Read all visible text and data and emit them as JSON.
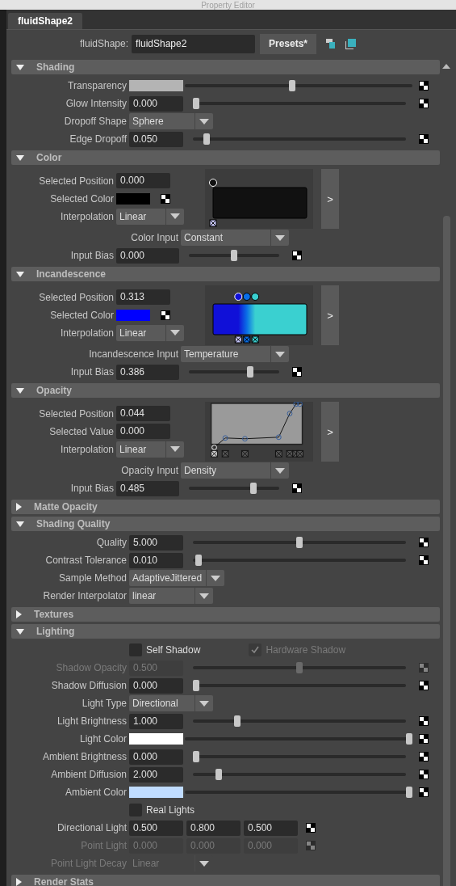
{
  "window": {
    "title": "Property Editor"
  },
  "tabs": [
    {
      "label": "fluidShape2",
      "selected": true
    }
  ],
  "header": {
    "label": "fluidShape:",
    "value": "fluidShape2",
    "button": "Presets*"
  },
  "sections": [
    {
      "title": "Shading",
      "expanded": true,
      "rows": [
        {
          "kind": "slider",
          "label": "Transparency",
          "color": "#b4b4b4",
          "level": 0.47,
          "disabled": false
        },
        {
          "kind": "slider",
          "label": "Glow Intensity",
          "value": "0.000",
          "level": 0,
          "disabled": false
        },
        {
          "kind": "dropdown",
          "label": "Dropoff Shape",
          "value": "Sphere",
          "disabled": false
        },
        {
          "kind": "slider",
          "label": "Edge Dropoff",
          "value": "0.050",
          "level": 0.05,
          "disabled": false
        }
      ]
    },
    {
      "title": "Color",
      "expanded": true,
      "rows": [
        {
          "kind": "gradient_ramp",
          "fields": [
            {
              "kind": "field",
              "label": "Selected Position",
              "value": "0.000"
            },
            {
              "kind": "swatch",
              "label": "Selected Color",
              "color": "#000000"
            },
            {
              "kind": "dropdown",
              "label": "Interpolation",
              "value": "Linear"
            }
          ],
          "ramp": {
            "stops": [
              {
                "color": "#111111",
                "selected": true
              }
            ]
          },
          "button": ">"
        },
        {
          "kind": "input_dropdown",
          "label": "Color Input",
          "value": "Constant",
          "disabled": false
        },
        {
          "kind": "bias",
          "label": "Input Bias",
          "value": "0.000",
          "level": 0.5,
          "disabled": false
        }
      ]
    },
    {
      "title": "Incandescence",
      "expanded": true,
      "rows": [
        {
          "kind": "gradient_ramp",
          "fields": [
            {
              "kind": "field",
              "label": "Selected Position",
              "value": "0.313"
            },
            {
              "kind": "swatch",
              "label": "Selected Color",
              "color": "#0000ff"
            },
            {
              "kind": "dropdown",
              "label": "Interpolation",
              "value": "Linear"
            }
          ],
          "ramp": {
            "stops": [
              {
                "color": "#1010d8",
                "selected": true
              },
              {
                "color": "#0a6ee6",
                "selected": false
              },
              {
                "color": "#3ad0d0",
                "selected": false
              }
            ]
          },
          "button": ">"
        },
        {
          "kind": "input_dropdown",
          "label": "Incandescence Input",
          "value": "Temperature",
          "disabled": false
        },
        {
          "kind": "bias",
          "label": "Input Bias",
          "value": "0.386",
          "level": 0.69,
          "disabled": false
        }
      ]
    },
    {
      "title": "Opacity",
      "expanded": true,
      "rows": [
        {
          "kind": "curve_ramp",
          "fields": [
            {
              "kind": "field",
              "label": "Selected Position",
              "value": "0.044"
            },
            {
              "kind": "field",
              "label": "Selected Value",
              "value": "0.000"
            },
            {
              "kind": "dropdown",
              "label": "Interpolation",
              "value": "Linear"
            }
          ],
          "ramp": {
            "stops": [
              {
                "selected": true
              },
              {
                "selected": false
              },
              {
                "selected": false
              },
              {
                "selected": false
              },
              {
                "selected": false
              },
              {
                "selected": false
              },
              {
                "selected": false
              }
            ]
          },
          "button": ">"
        },
        {
          "kind": "input_dropdown",
          "label": "Opacity Input",
          "value": "Density",
          "disabled": false
        },
        {
          "kind": "bias",
          "label": "Input Bias",
          "value": "0.485",
          "level": 0.73,
          "disabled": false
        }
      ]
    },
    {
      "title": "Matte Opacity",
      "expanded": false
    },
    {
      "title": "Shading Quality",
      "expanded": true,
      "rows": [
        {
          "kind": "slider",
          "label": "Quality",
          "value": "5.000",
          "level": 0.5,
          "disabled": false
        },
        {
          "kind": "slider",
          "label": "Contrast Tolerance",
          "value": "0.010",
          "level": 0.01,
          "disabled": false
        },
        {
          "kind": "dropdown",
          "label": "Sample Method",
          "value": "AdaptiveJittered",
          "disabled": false
        },
        {
          "kind": "dropdown",
          "label": "Render Interpolator",
          "value": "linear",
          "disabled": false
        }
      ]
    },
    {
      "title": "Textures",
      "expanded": false
    },
    {
      "title": "Lighting",
      "expanded": true,
      "rows": [
        {
          "kind": "checks",
          "items": [
            {
              "label": "Self Shadow",
              "checked": false,
              "disabled": false
            },
            {
              "label": "Hardware Shadow",
              "checked": true,
              "disabled": true
            }
          ]
        },
        {
          "kind": "slider",
          "label": "Shadow Opacity",
          "value": "0.500",
          "level": 0.5,
          "disabled": true
        },
        {
          "kind": "slider",
          "label": "Shadow Diffusion",
          "value": "0.000",
          "level": 0,
          "disabled": false
        },
        {
          "kind": "dropdown",
          "label": "Light Type",
          "value": "Directional",
          "disabled": false
        },
        {
          "kind": "slider",
          "label": "Light Brightness",
          "value": "1.000",
          "level": 0.2,
          "disabled": false
        },
        {
          "kind": "slider",
          "label": "Light Color",
          "color": "#ffffff",
          "level": 1,
          "disabled": false
        },
        {
          "kind": "slider",
          "label": "Ambient Brightness",
          "value": "0.000",
          "level": 0,
          "disabled": false
        },
        {
          "kind": "slider",
          "label": "Ambient Diffusion",
          "value": "2.000",
          "level": 0.11,
          "disabled": false
        },
        {
          "kind": "slider",
          "label": "Ambient Color",
          "color": "#c0dcff",
          "level": 1,
          "disabled": false
        },
        {
          "kind": "checks",
          "items": [
            {
              "label": "Real Lights",
              "checked": false,
              "disabled": false
            }
          ]
        },
        {
          "kind": "triple",
          "label": "Directional Light",
          "values": [
            "0.500",
            "0.800",
            "0.500"
          ],
          "disabled": false
        },
        {
          "kind": "triple",
          "label": "Point Light",
          "values": [
            "0.000",
            "0.000",
            "0.000"
          ],
          "disabled": true
        },
        {
          "kind": "dropdown",
          "label": "Point Light Decay",
          "value": "Linear",
          "disabled": true
        }
      ]
    },
    {
      "title": "Render Stats",
      "expanded": false
    }
  ]
}
